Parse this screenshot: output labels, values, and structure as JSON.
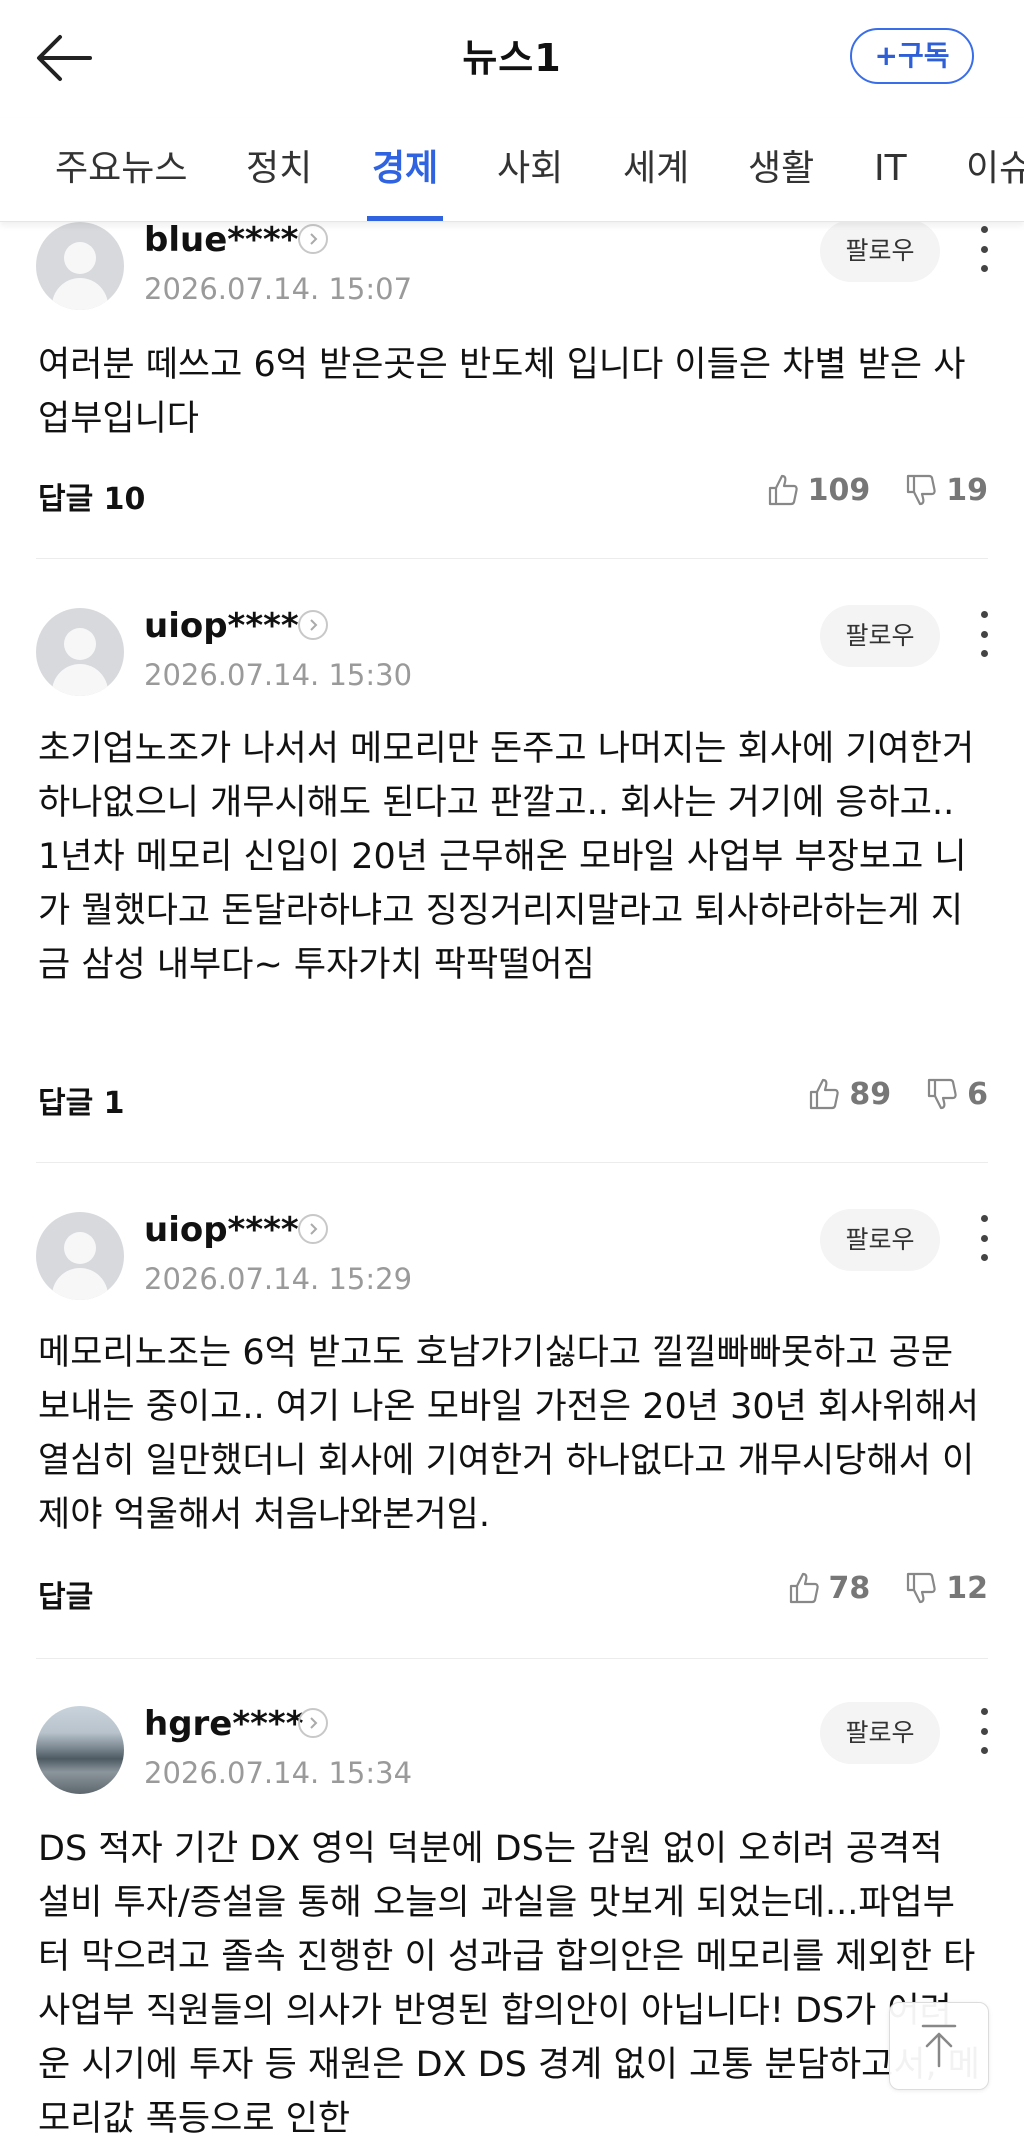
{
  "header": {
    "title": "뉴스1",
    "subscribe_label": "+구독"
  },
  "tabs": [
    {
      "label": "주요뉴스"
    },
    {
      "label": "정치"
    },
    {
      "label": "경제",
      "active": true
    },
    {
      "label": "사회"
    },
    {
      "label": "세계"
    },
    {
      "label": "생활"
    },
    {
      "label": "IT"
    },
    {
      "label": "이슈"
    }
  ],
  "follow_label": "팔로우",
  "comments": [
    {
      "username": "blue****",
      "date": "2026.07.14. 15:07",
      "text": "여러분 떼쓰고 6억 받은곳은 반도체 입니다 이들은 차별 받은 사업부입니다",
      "reply": "답글 10",
      "likes": "109",
      "dislikes": "19"
    },
    {
      "username": "uiop****",
      "date": "2026.07.14. 15:30",
      "text": "초기업노조가 나서서 메모리만 돈주고 나머지는 회사에 기여한거 하나없으니 개무시해도 된다고 판깔고.. 회사는 거기에 응하고.. 1년차 메모리 신입이 20년 근무해온 모바일 사업부 부장보고 니가 뭘했다고 돈달라하냐고 징징거리지말라고 퇴사하라하는게 지금 삼성 내부다~ 투자가치 팍팍떨어짐",
      "reply": "답글 1",
      "likes": "89",
      "dislikes": "6"
    },
    {
      "username": "uiop****",
      "date": "2026.07.14. 15:29",
      "text": "메모리노조는 6억 받고도 호남가기싫다고 낄낄빠빠못하고 공문보내는 중이고.. 여기 나온 모바일 가전은 20년 30년 회사위해서 열심히 일만했더니 회사에 기여한거 하나없다고 개무시당해서 이제야 억울해서 처음나와본거임.",
      "reply": "답글",
      "likes": "78",
      "dislikes": "12"
    },
    {
      "username": "hgre****",
      "date": "2026.07.14. 15:34",
      "text": "DS 적자 기간 DX 영익 덕분에 DS는 감원 없이 오히려 공격적 설비 투자/증설을 통해 오늘의 과실을 맛보게 되었는데...파업부터 막으려고 졸속 진행한 이 성과급 합의안은 메모리를 제외한 타 사업부 직원들의 의사가 반영된 합의안이 아닙니다! DS가 어려운 시기에 투자 등 재원은 DX DS 경계 없이 고통 분담하고서, 메모리값 폭등으로 인한"
    }
  ]
}
